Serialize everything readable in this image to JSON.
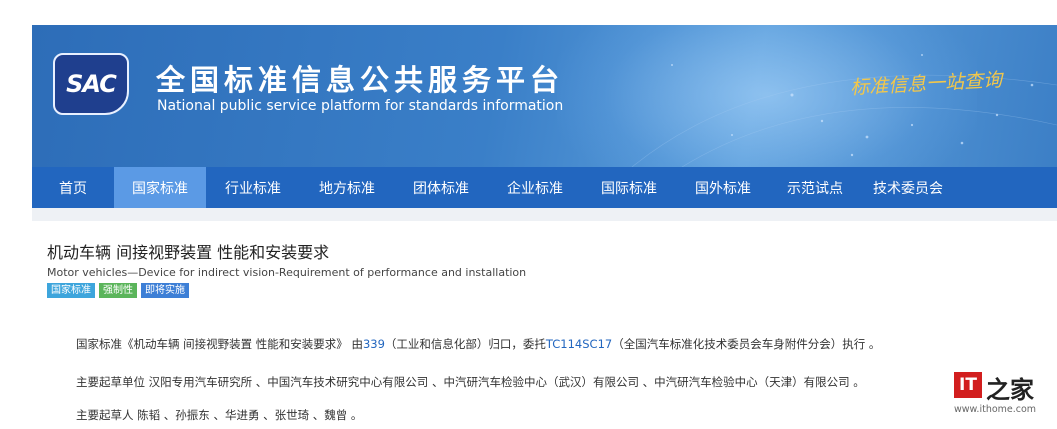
{
  "header": {
    "logo_text": "SAC",
    "site_title": "全国标准信息公共服务平台",
    "site_subtitle": "National public service platform  for standards information",
    "slogan": "标准信息一站查询"
  },
  "nav": {
    "items": [
      {
        "label": "首页"
      },
      {
        "label": "国家标准",
        "active": true
      },
      {
        "label": "行业标准"
      },
      {
        "label": "地方标准"
      },
      {
        "label": "团体标准"
      },
      {
        "label": "企业标准"
      },
      {
        "label": "国际标准"
      },
      {
        "label": "国外标准"
      },
      {
        "label": "示范试点"
      },
      {
        "label": "技术委员会"
      }
    ]
  },
  "standard": {
    "title": "机动车辆 间接视野装置 性能和安装要求",
    "title_en": "Motor vehicles—Device for indirect vision-Requirement of performance and installation",
    "tags": [
      "国家标准",
      "强制性",
      "即将实施"
    ],
    "description": {
      "prefix": "国家标准《机动车辆 间接视野装置 性能和安装要求》 由",
      "org_code": "339",
      "middle": "（工业和信息化部）归口，委托",
      "committee_code": "TC114SC17",
      "suffix": "（全国汽车标准化技术委员会车身附件分会）执行 。"
    },
    "drafting_units_label": "主要起草单位",
    "drafting_units": "汉阳专用汽车研究所 、中国汽车技术研究中心有限公司 、中汽研汽车检验中心（武汉）有限公司 、中汽研汽车检验中心（天津）有限公司 。",
    "drafters_label": "主要起草人",
    "drafters": "陈韬 、孙振东 、华进勇 、张世琦 、魏曾 。"
  },
  "watermark": {
    "logo_text": "IT",
    "logo_glyph": "之家",
    "url": "www.ithome.com"
  },
  "colors": {
    "nav_bg": "#2266bf",
    "nav_active": "#5b9ae5",
    "link": "#2266bf",
    "tag_national": "#3da5dc",
    "tag_mandatory": "#5bb55b",
    "tag_upcoming": "#3d7fd6"
  }
}
